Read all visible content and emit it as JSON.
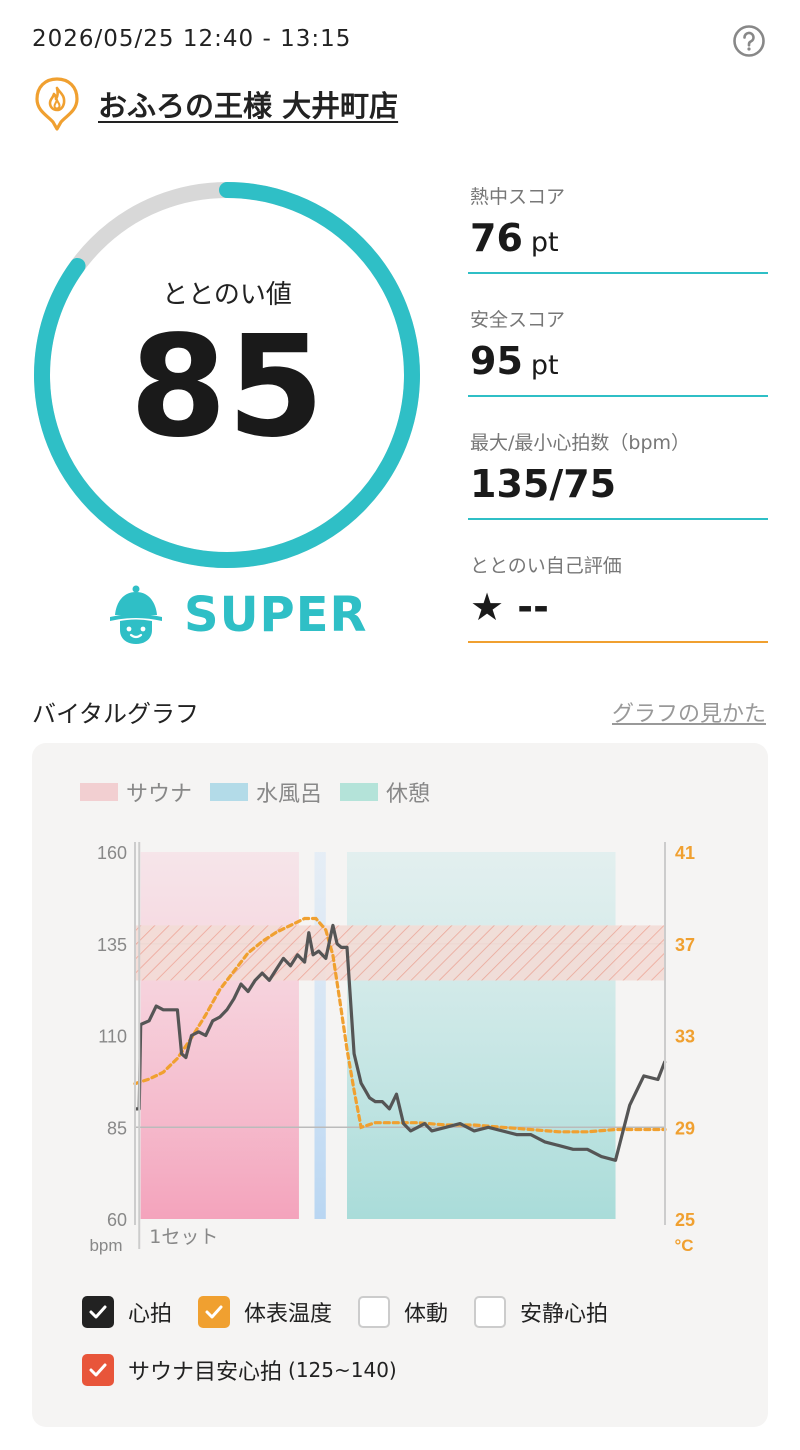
{
  "header": {
    "datetime": "2026/05/25 12:40 - 13:15",
    "store_name": "おふろの王様 大井町店"
  },
  "colors": {
    "accent": "#2fbfc6",
    "orange": "#f0a030",
    "heart": "#555555",
    "sauna": "#f4a3bc",
    "water": "#b9d6f2",
    "rest": "#a9dcd9",
    "target": "#e8553a"
  },
  "icons": {
    "help": "help-circle-icon",
    "store": "flame-pin-icon",
    "rank": "sauna-mascot-icon"
  },
  "totonoi": {
    "label": "ととのい値",
    "value": "85",
    "fraction": 0.85,
    "rank": "SUPER"
  },
  "scores": [
    {
      "title": "熱中スコア",
      "value": "76",
      "unit": "pt"
    },
    {
      "title": "安全スコア",
      "value": "95",
      "unit": "pt"
    },
    {
      "title": "最大/最小心拍数（bpm）",
      "value": "135/75",
      "unit": ""
    },
    {
      "title": "ととのい自己評価",
      "value": "★ --",
      "unit": ""
    }
  ],
  "graph": {
    "title": "バイタルグラフ",
    "help_link": "グラフの見かた",
    "legend": [
      "サウナ",
      "水風呂",
      "休憩"
    ],
    "set_label": "1セット",
    "checkboxes": [
      {
        "label": "心拍",
        "checked": true,
        "color": "#222222"
      },
      {
        "label": "体表温度",
        "checked": true,
        "color": "#f0a030"
      },
      {
        "label": "体動",
        "checked": false,
        "color": ""
      },
      {
        "label": "安静心拍",
        "checked": false,
        "color": ""
      },
      {
        "label": "サウナ目安心拍",
        "sub": "(125~140)",
        "checked": true,
        "color": "#e8553a"
      }
    ]
  },
  "chart_data": {
    "type": "line",
    "x_unit": "minutes from start",
    "y_left": {
      "label": "bpm",
      "ticks": [
        160,
        135,
        110,
        85,
        60
      ],
      "range": [
        60,
        160
      ]
    },
    "y_right": {
      "label": "°C",
      "ticks": [
        41,
        37,
        33,
        29,
        25
      ],
      "range": [
        25,
        41
      ]
    },
    "target_band_bpm": [
      125,
      140
    ],
    "phases": [
      {
        "name": "サウナ",
        "start": 0.4,
        "end": 11.6
      },
      {
        "name": "水風呂",
        "start": 12.7,
        "end": 13.5
      },
      {
        "name": "休憩",
        "start": 15.0,
        "end": 34.0
      }
    ],
    "series": [
      {
        "name": "心拍",
        "x": [
          0,
          0.3,
          0.4,
          1.0,
          1.5,
          2.0,
          2.5,
          3.0,
          3.3,
          3.6,
          4.0,
          4.5,
          5.0,
          5.5,
          6.0,
          6.5,
          7.0,
          7.5,
          8.0,
          8.5,
          9.0,
          9.5,
          10.0,
          10.5,
          11.0,
          11.5,
          12.0,
          12.3,
          12.6,
          13.0,
          13.5,
          14.0,
          14.3,
          14.6,
          15.0,
          15.5,
          16.0,
          16.3,
          16.6,
          17.0,
          17.5,
          18.0,
          18.5,
          19.0,
          19.5,
          20.0,
          20.5,
          21.0,
          22.0,
          23.0,
          24.0,
          25.0,
          26.0,
          27.0,
          28.0,
          29.0,
          30.0,
          31.0,
          32.0,
          33.0,
          34.0,
          35.0,
          36.0,
          37.0,
          37.5
        ],
        "y": [
          90,
          90,
          113,
          114,
          118,
          117,
          117,
          117,
          105,
          104,
          110,
          111,
          110,
          114,
          115,
          117,
          120,
          124,
          122,
          125,
          127,
          125,
          128,
          131,
          129,
          132,
          130,
          138,
          132,
          133,
          131,
          140,
          135,
          134,
          134,
          105,
          97,
          95,
          93,
          92,
          92,
          90,
          94,
          86,
          84,
          85,
          86,
          84,
          85,
          86,
          84,
          85,
          84,
          83,
          83,
          81,
          80,
          79,
          79,
          77,
          76,
          91,
          99,
          98,
          103
        ]
      },
      {
        "name": "体表温度",
        "x": [
          0,
          1,
          2,
          3,
          4,
          5,
          6,
          7,
          8,
          9,
          10,
          11,
          12,
          12.8,
          13.5,
          14.0,
          14.5,
          15.0,
          15.5,
          16.0,
          16.5,
          17.0,
          18,
          20,
          22,
          24,
          26,
          28,
          30,
          32,
          34,
          36,
          37.5
        ],
        "y": [
          30.9,
          31.1,
          31.4,
          32.0,
          32.9,
          33.9,
          35.0,
          35.8,
          36.6,
          37.1,
          37.5,
          37.8,
          38.1,
          38.1,
          37.6,
          36.5,
          34.5,
          32.4,
          30.6,
          29.0,
          29.1,
          29.2,
          29.2,
          29.2,
          29.1,
          29.1,
          29.0,
          28.9,
          28.8,
          28.8,
          28.9,
          28.9,
          28.9
        ]
      }
    ]
  }
}
